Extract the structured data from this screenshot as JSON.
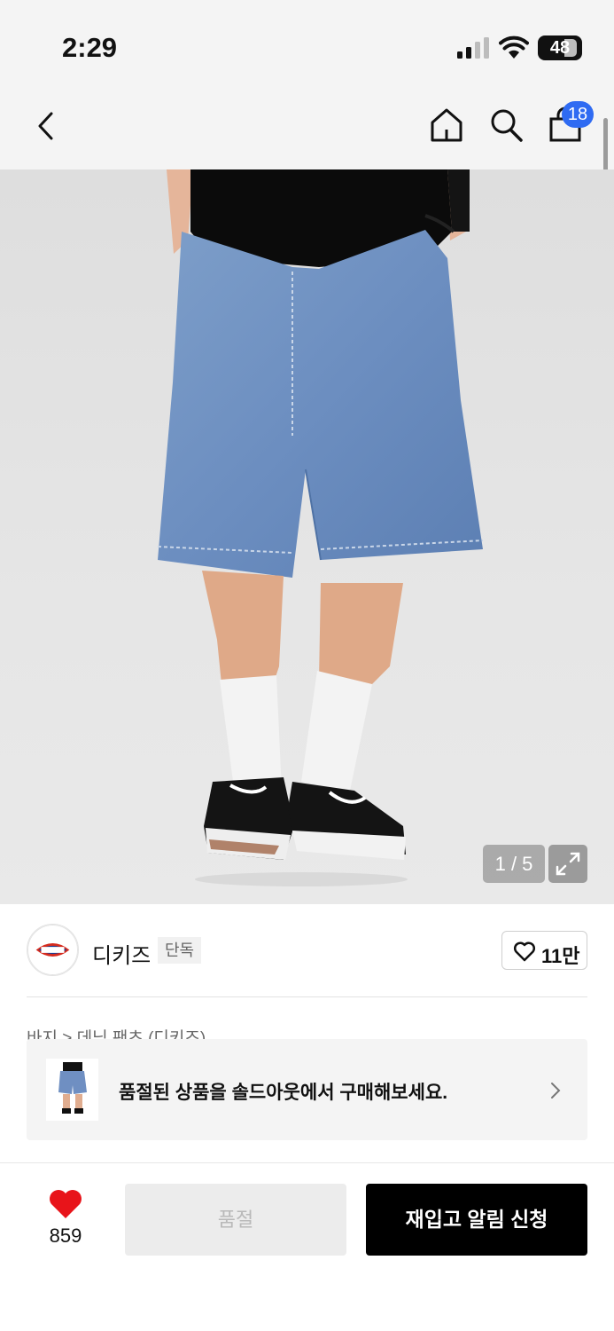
{
  "status_bar": {
    "time": "2:29",
    "battery": "48"
  },
  "header": {
    "cart_count": "18"
  },
  "gallery": {
    "counter": "1 / 5"
  },
  "brand": {
    "name": "디키즈",
    "tag": "단독",
    "likes": "11만"
  },
  "breadcrumb": "바지 > 데님 팬츠 (디키즈)",
  "soldout_banner": {
    "text": "품절된 상품을 솔드아웃에서 구매해보세요."
  },
  "bottom_bar": {
    "wish_count": "859",
    "soldout_label": "품절",
    "restock_label": "재입고 알림 신청"
  },
  "colors": {
    "accent_blue": "#2f6bf2",
    "heart_red": "#e8141a",
    "primary_black": "#000000"
  }
}
